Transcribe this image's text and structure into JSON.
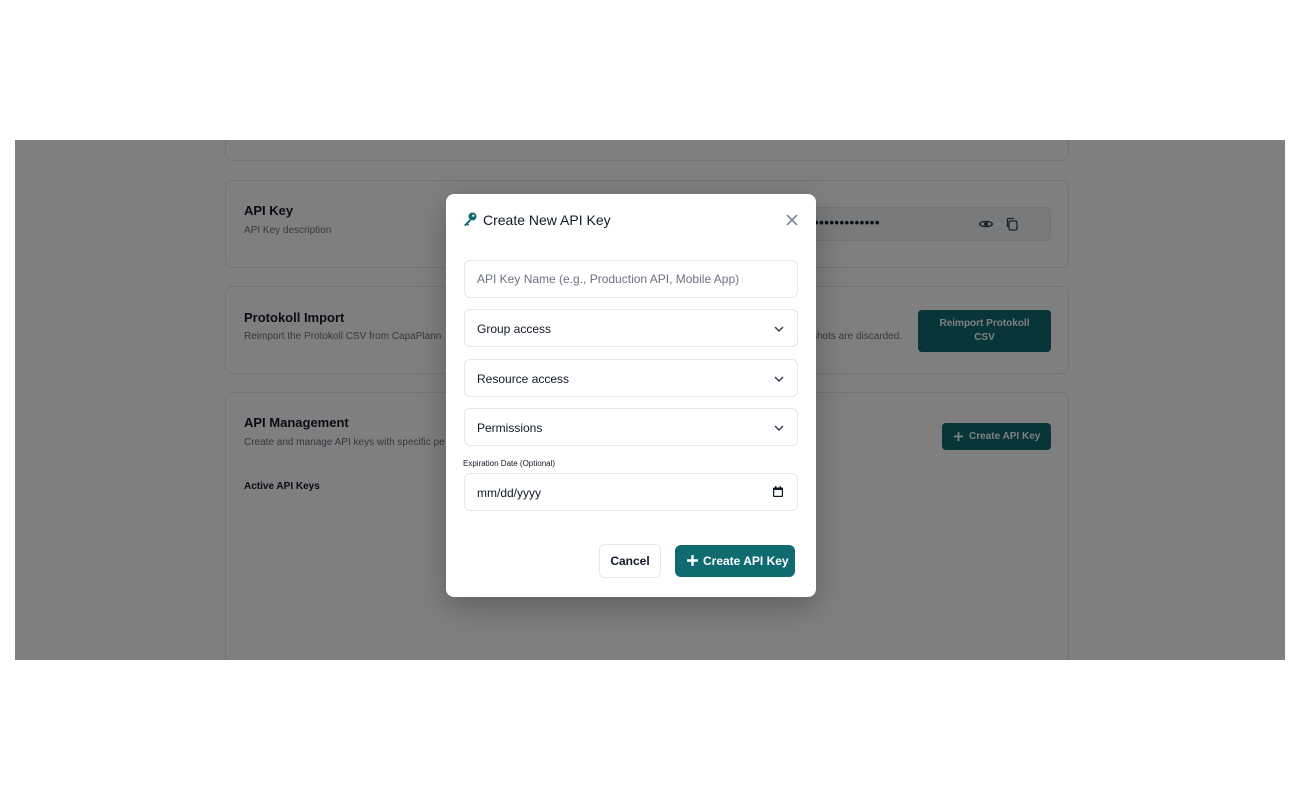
{
  "background": {
    "api_key_card": {
      "title": "API Key",
      "description": "API Key description",
      "masked_key": "•••••••••••••••••"
    },
    "protokoll_card": {
      "title": "Protokoll Import",
      "description": "Reimport the Protokoll CSV from CapaPlann",
      "description_tail": "shots are discarded.",
      "button_label": "Reimport Protokoll CSV"
    },
    "api_management_card": {
      "title": "API Management",
      "description": "Create and manage API keys with specific pe",
      "active_keys_label": "Active API Keys",
      "create_button_label": "Create API Key"
    }
  },
  "modal": {
    "title": "Create New API Key",
    "name_placeholder": "API Key Name (e.g., Production API, Mobile App)",
    "group_access": "Group access",
    "resource_access": "Resource access",
    "permissions": "Permissions",
    "expiration_label": "Expiration Date (Optional)",
    "date_placeholder": "mm/dd/yyyy",
    "cancel_label": "Cancel",
    "create_label": "Create API Key"
  },
  "colors": {
    "accent": "#0f6b70",
    "overlay": "rgba(0,0,0,0.5)",
    "border": "#e5e7eb"
  },
  "icons": {
    "title_icon": "key-icon",
    "close": "close-icon",
    "select": "chevron-down-icon",
    "date": "calendar-icon",
    "visibility": "eye-icon",
    "copy": "copy-icon",
    "add": "plus-icon"
  }
}
